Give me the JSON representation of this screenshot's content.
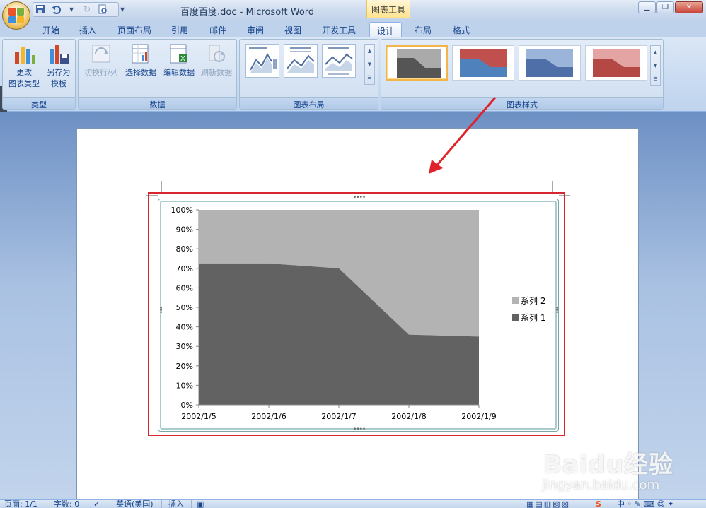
{
  "window": {
    "title": "百度百度.doc - Microsoft Word",
    "context_tools_label": "图表工具",
    "controls": [
      "minimize",
      "restore",
      "close"
    ]
  },
  "tabs": [
    {
      "label": "开始",
      "active": false
    },
    {
      "label": "插入",
      "active": false
    },
    {
      "label": "页面布局",
      "active": false
    },
    {
      "label": "引用",
      "active": false
    },
    {
      "label": "邮件",
      "active": false
    },
    {
      "label": "审阅",
      "active": false
    },
    {
      "label": "视图",
      "active": false
    },
    {
      "label": "开发工具",
      "active": false
    },
    {
      "label": "设计",
      "active": true
    },
    {
      "label": "布局",
      "active": false
    },
    {
      "label": "格式",
      "active": false
    }
  ],
  "ribbon": {
    "groups": {
      "type": {
        "label": "类型",
        "change_type": "更改\n图表类型",
        "change_type_line1": "更改",
        "change_type_line2": "图表类型",
        "save_template_line1": "另存为",
        "save_template_line2": "模板"
      },
      "data": {
        "label": "数据",
        "switch_row_col": "切换行/列",
        "select_data": "选择数据",
        "edit_data": "编辑数据",
        "refresh_data": "刷新数据"
      },
      "layout": {
        "label": "图表布局"
      },
      "styles": {
        "label": "图表样式"
      }
    }
  },
  "colors": {
    "series1": "#626262",
    "series2": "#b3b3b3",
    "highlight_red": "#d7262e",
    "style_blue": "#4f81bd",
    "style_red": "#c0504d"
  },
  "chart_data": {
    "type": "area",
    "stacking": "percent",
    "categories": [
      "2002/1/5",
      "2002/1/6",
      "2002/1/7",
      "2002/1/8",
      "2002/1/9"
    ],
    "series": [
      {
        "name": "系列 1",
        "values": [
          72.5,
          72.5,
          70,
          36,
          35
        ]
      },
      {
        "name": "系列 2",
        "values": [
          27.5,
          27.5,
          30,
          64,
          65
        ]
      }
    ],
    "y_ticks": [
      "0%",
      "10%",
      "20%",
      "30%",
      "40%",
      "50%",
      "60%",
      "70%",
      "80%",
      "90%",
      "100%"
    ],
    "ylim": [
      0,
      100
    ],
    "legend": {
      "position": "right",
      "entries": [
        "系列 2",
        "系列 1"
      ]
    },
    "grid": false
  },
  "statusbar": {
    "page": "页面: 1/1",
    "words": "字数: 0",
    "language": "英语(美国)",
    "mode": "插入"
  },
  "watermark": {
    "brand": "Baidu经验",
    "url": "jingyan.baidu.com"
  }
}
